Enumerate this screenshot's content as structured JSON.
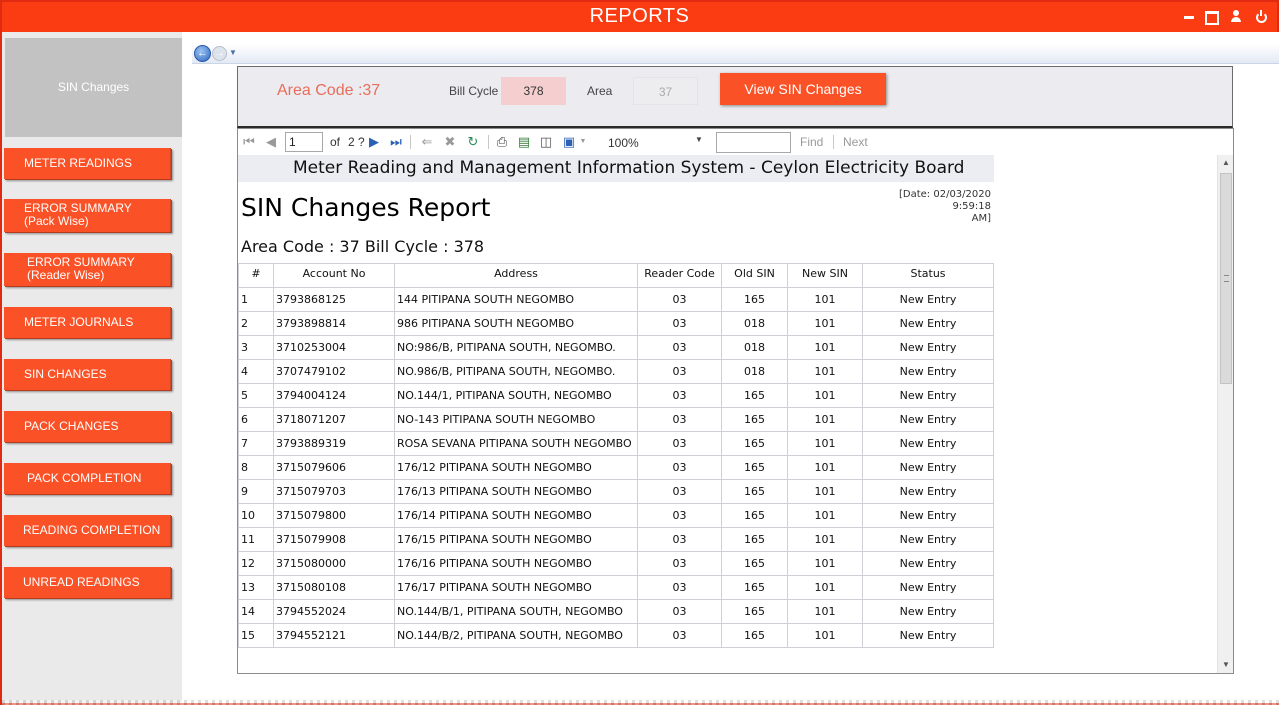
{
  "window": {
    "title": "REPORTS"
  },
  "sidebar": {
    "header": "SIN Changes",
    "buttons": [
      {
        "label": "METER READINGS"
      },
      {
        "label_line1": "ERROR SUMMARY",
        "label_line2": "(Pack Wise)"
      },
      {
        "label_line1": "ERROR SUMMARY",
        "label_line2": "(Reader Wise)"
      },
      {
        "label": "METER JOURNALS"
      },
      {
        "label": "SIN CHANGES"
      },
      {
        "label": "PACK CHANGES"
      },
      {
        "label": "PACK COMPLETION"
      },
      {
        "label": "READING COMPLETION"
      },
      {
        "label": "UNREAD READINGS"
      }
    ]
  },
  "params": {
    "area_code_label": "Area Code :37",
    "bill_cycle_label": "Bill Cycle",
    "bill_cycle_value": "378",
    "area_label": "Area",
    "area_value": "37",
    "view_button": "View SIN Changes"
  },
  "toolbar": {
    "page_value": "1",
    "of_label": "of",
    "total_pages": "2 ?",
    "zoom": "100%",
    "find_label": "Find",
    "next_label": "Next"
  },
  "report": {
    "banner": "Meter Reading and Management Information System - Ceylon Electricity Board",
    "date_line1": "[Date: 02/03/2020 9:59:18",
    "date_line2": "AM]",
    "title": "SIN Changes Report",
    "subtitle": "Area Code : 37 Bill Cycle : 378",
    "columns": [
      "#",
      "Account No",
      "Address",
      "Reader Code",
      "Old SIN",
      "New SIN",
      "Status"
    ],
    "rows": [
      [
        "1",
        "3793868125",
        "144 PITIPANA SOUTH NEGOMBO",
        "03",
        "165",
        "101",
        "New Entry"
      ],
      [
        "2",
        "3793898814",
        "986 PITIPANA SOUTH NEGOMBO",
        "03",
        "018",
        "101",
        "New Entry"
      ],
      [
        "3",
        "3710253004",
        "NO:986/B, PITIPANA SOUTH, NEGOMBO.",
        "03",
        "018",
        "101",
        "New Entry"
      ],
      [
        "4",
        "3707479102",
        "NO.986/B, PITIPANA SOUTH, NEGOMBO.",
        "03",
        "018",
        "101",
        "New Entry"
      ],
      [
        "5",
        "3794004124",
        "NO.144/1, PITIPANA SOUTH, NEGOMBO",
        "03",
        "165",
        "101",
        "New Entry"
      ],
      [
        "6",
        "3718071207",
        "NO-143 PITIPANA SOUTH NEGOMBO",
        "03",
        "165",
        "101",
        "New Entry"
      ],
      [
        "7",
        "3793889319",
        "ROSA SEVANA PITIPANA SOUTH NEGOMBO",
        "03",
        "165",
        "101",
        "New Entry"
      ],
      [
        "8",
        "3715079606",
        "176/12 PITIPANA SOUTH NEGOMBO",
        "03",
        "165",
        "101",
        "New Entry"
      ],
      [
        "9",
        "3715079703",
        "176/13 PITIPANA SOUTH NEGOMBO",
        "03",
        "165",
        "101",
        "New Entry"
      ],
      [
        "10",
        "3715079800",
        "176/14 PITIPANA SOUTH NEGOMBO",
        "03",
        "165",
        "101",
        "New Entry"
      ],
      [
        "11",
        "3715079908",
        "176/15 PITIPANA SOUTH NEGOMBO",
        "03",
        "165",
        "101",
        "New Entry"
      ],
      [
        "12",
        "3715080000",
        "176/16 PITIPANA SOUTH NEGOMBO",
        "03",
        "165",
        "101",
        "New Entry"
      ],
      [
        "13",
        "3715080108",
        "176/17 PITIPANA SOUTH NEGOMBO",
        "03",
        "165",
        "101",
        "New Entry"
      ],
      [
        "14",
        "3794552024",
        "NO.144/B/1, PITIPANA SOUTH, NEGOMBO",
        "03",
        "165",
        "101",
        "New Entry"
      ],
      [
        "15",
        "3794552121",
        "NO.144/B/2, PITIPANA SOUTH, NEGOMBO",
        "03",
        "165",
        "101",
        "New Entry"
      ]
    ]
  },
  "colors": {
    "accent": "#fb3c12",
    "button": "#fb5126",
    "sidebar_bg": "#eaeaea",
    "panel_bg": "#ecebf0"
  }
}
